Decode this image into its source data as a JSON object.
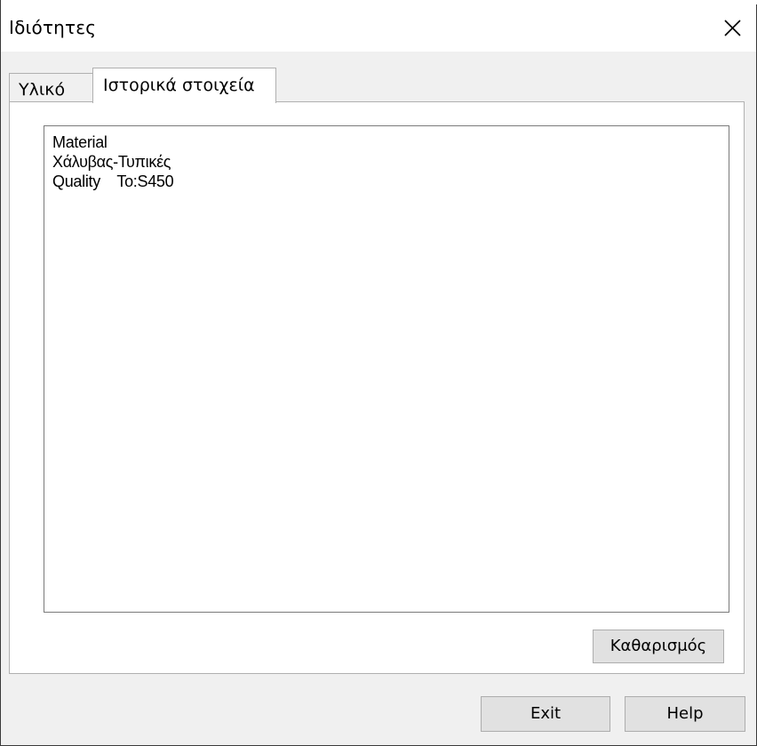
{
  "window": {
    "title": "Ιδιότητες"
  },
  "tabs": [
    {
      "label": "Υλικό",
      "active": false
    },
    {
      "label": "Ιστορικά στοιχεία",
      "active": true
    }
  ],
  "history": {
    "lines": [
      "Material",
      "Χάλυβας-Τυπικές",
      "Quality    To:S450"
    ]
  },
  "buttons": {
    "clear_label": "Καθαρισμός",
    "exit_label": "Exit",
    "help_label": "Help"
  },
  "icons": {
    "close": "close-icon"
  },
  "colors": {
    "window_bg": "#f0f0f0",
    "panel_bg": "#ffffff",
    "button_bg": "#e1e1e1",
    "border": "#adadad"
  }
}
